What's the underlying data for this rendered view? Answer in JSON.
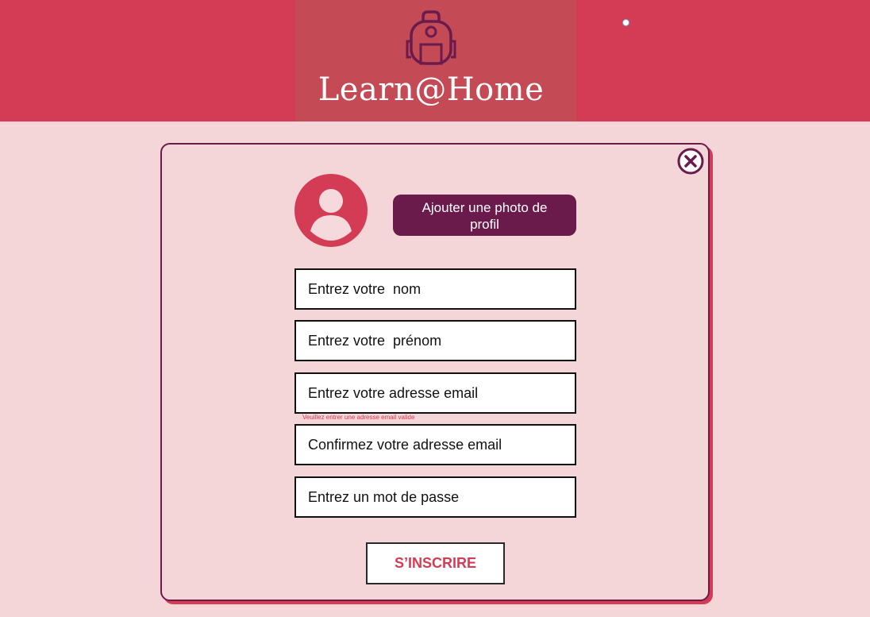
{
  "header": {
    "app_title": "Learn@Home",
    "logo_icon": "backpack-icon"
  },
  "colors": {
    "header_bg": "#d33c54",
    "logo_block_bg": "#c44a55",
    "page_bg": "#f4d6d9",
    "primary_dark": "#6b1a4c",
    "accent": "#d33c54"
  },
  "modal": {
    "close_icon": "close-circle-icon",
    "avatar_icon": "user-avatar-icon",
    "add_photo_label": "Ajouter une photo de profil",
    "fields": {
      "last_name_placeholder": "Entrez votre  nom",
      "first_name_placeholder": "Entrez votre  prénom",
      "email_placeholder": "Entrez votre adresse email",
      "email_error": "Veuillez entrer une adresse email valide",
      "confirm_email_placeholder": "Confirmez votre adresse email",
      "password_placeholder": "Entrez un mot de passe"
    },
    "submit_label": "S’INSCRIRE"
  }
}
